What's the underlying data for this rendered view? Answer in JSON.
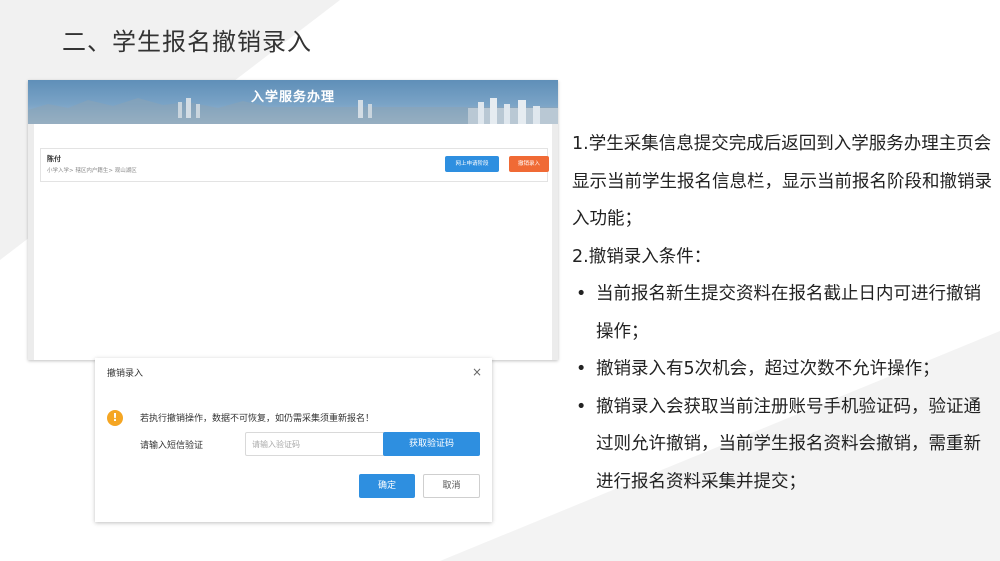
{
  "slide": {
    "title": "二、学生报名撤销录入"
  },
  "screenshot": {
    "banner_title": "入学服务办理",
    "card": {
      "name": "陈付",
      "path": "小学入学> 辖区内户籍生> 观山湖区",
      "stage_button": "网上申请阶段",
      "revoke_button": "撤销录入"
    }
  },
  "dialog": {
    "title": "撤销录入",
    "close_icon": "×",
    "warning_icon": "!",
    "warning_text": "若执行撤销操作，数据不可恢复，如仍需采集须重新报名！",
    "sms_label": "请输入短信验证",
    "sms_placeholder": "请输入验证码",
    "get_code_button": "获取验证码",
    "confirm_button": "确定",
    "cancel_button": "取消"
  },
  "description": {
    "para1": "1.学生采集信息提交完成后返回到入学服务办理主页会显示当前学生报名信息栏，显示当前报名阶段和撤销录入功能；",
    "para2": "2.撤销录入条件：",
    "bullet_char": "•",
    "bullets": [
      "当前报名新生提交资料在报名截止日内可进行撤销操作；",
      "撤销录入有5次机会，超过次数不允许操作；",
      "撤销录入会获取当前注册账号手机验证码，验证通过则允许撤销，当前学生报名资料会撤销，需重新进行报名资料采集并提交；"
    ]
  },
  "colors": {
    "primary_blue": "#2e8fe0",
    "revoke_orange": "#f06a35",
    "warning_yellow": "#f5a623"
  }
}
